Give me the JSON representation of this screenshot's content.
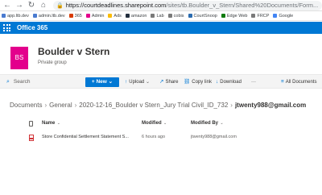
{
  "browser": {
    "url_host": "https://courtdeadlines.sharepoint.com",
    "url_path": "/sites/tb.Boulder_v_Stern/Shared%20Documents/Form...",
    "bookmarks": [
      {
        "label": "app.ltb.dev",
        "color": "#4a7bd0"
      },
      {
        "label": "admin.ltb.dev",
        "color": "#4a7bd0"
      },
      {
        "label": "365",
        "color": "#d83b01"
      },
      {
        "label": "Admin",
        "color": "#e3008c"
      },
      {
        "label": "Ads",
        "color": "#fbbc05"
      },
      {
        "label": "amazon",
        "color": "#232f3e"
      },
      {
        "label": "Lab",
        "color": "#7a7a7a"
      },
      {
        "label": "cobis",
        "color": "#7a7a7a"
      },
      {
        "label": "CourtSnoop",
        "color": "#2b6cb0"
      },
      {
        "label": "Edge Web",
        "color": "#0f7b0f"
      },
      {
        "label": "FRCP",
        "color": "#7a7a7a"
      },
      {
        "label": "Google",
        "color": "#4285f4"
      }
    ]
  },
  "suite": {
    "title": "Office 365"
  },
  "site": {
    "logo_initials": "BS",
    "title": "Boulder v Stern",
    "subtitle": "Private group"
  },
  "commandbar": {
    "search_label": "Search",
    "new_label": "New",
    "upload_label": "Upload",
    "share_label": "Share",
    "copy_link_label": "Copy link",
    "download_label": "Download",
    "more_label": "···",
    "all_documents_label": "All Documents"
  },
  "breadcrumb": {
    "items": [
      "Documents",
      "General",
      "2020-12-16_Boulder v Stern_Jury Trial Civil_ID_732"
    ],
    "current": "jtwenty988@gmail.com"
  },
  "table": {
    "headers": {
      "name": "Name",
      "modified": "Modified",
      "modified_by": "Modified By"
    },
    "rows": [
      {
        "name": "Store Confidential Settlement Statement S...",
        "modified": "6 hours ago",
        "modified_by": "jtwenty988@gmail.com"
      }
    ]
  },
  "colors": {
    "suite_bar": "#0078d4",
    "logo": "#e3008c",
    "accent": "#0078d4"
  }
}
